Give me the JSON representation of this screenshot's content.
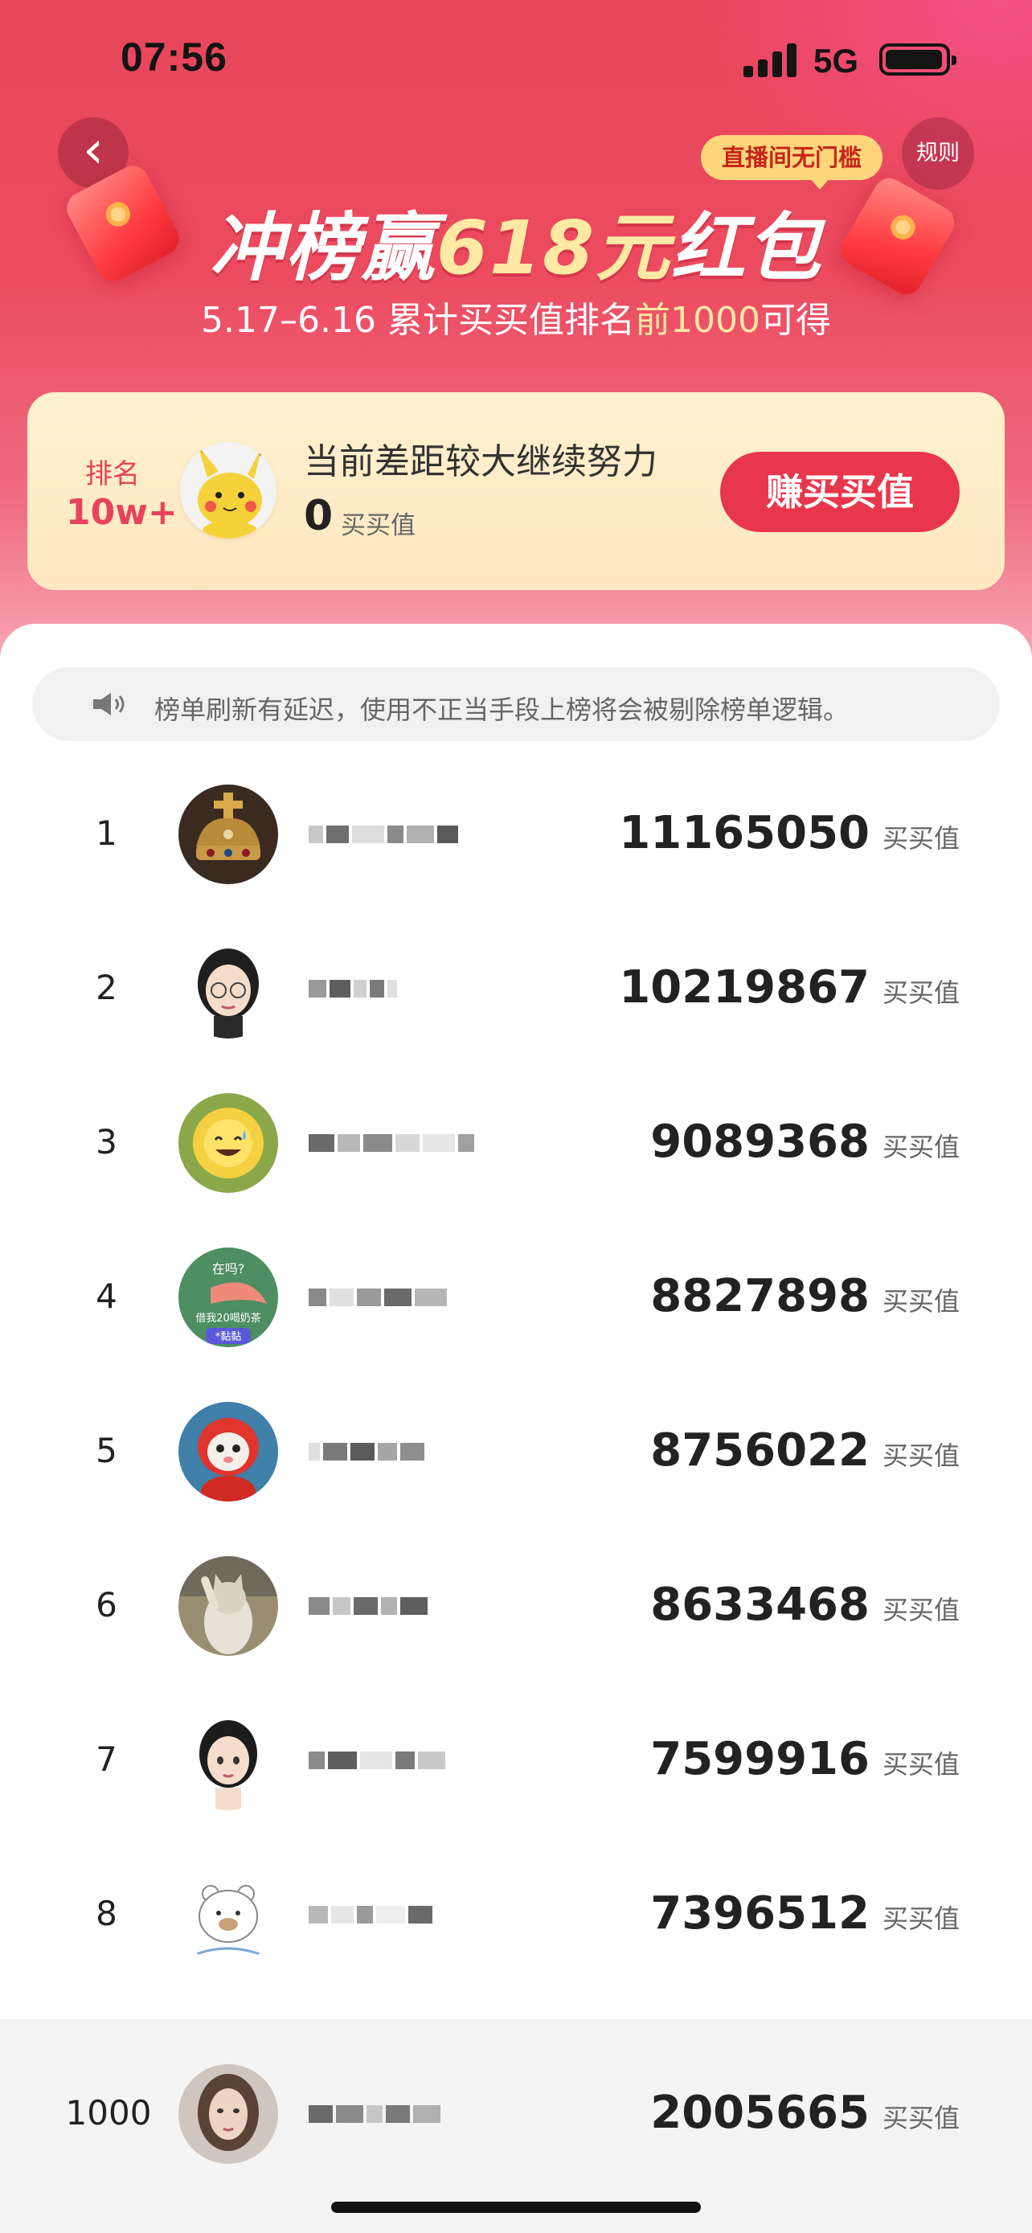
{
  "status_bar": {
    "time": "07:56",
    "network": "5G"
  },
  "header": {
    "rules_label": "规则",
    "badge": "直播间无门槛",
    "title_prefix": "冲榜赢",
    "title_highlight": "618元",
    "title_suffix": "红包",
    "subtitle_prefix": "5.17–6.16 累计买买值排名",
    "subtitle_highlight": "前1000",
    "subtitle_suffix": "可得"
  },
  "my_rank": {
    "rank_label": "排名",
    "rank_value": "10w+",
    "status": "当前差距较大继续努力",
    "score": "0",
    "score_unit": "买买值",
    "earn_button": "赚买买值"
  },
  "notice": "榜单刷新有延迟，使用不正当手段上榜将会被剔除榜单逻辑。",
  "leaderboard": [
    {
      "rank": "1",
      "score": "11165050",
      "unit": "买买值",
      "avatar": "crown"
    },
    {
      "rank": "2",
      "score": "10219867",
      "unit": "买买值",
      "avatar": "girl-glasses"
    },
    {
      "rank": "3",
      "score": "9089368",
      "unit": "买买值",
      "avatar": "sun-emoji"
    },
    {
      "rank": "4",
      "score": "8827898",
      "unit": "买买值",
      "avatar": "sticker"
    },
    {
      "rank": "5",
      "score": "8756022",
      "unit": "买买值",
      "avatar": "red-monkey"
    },
    {
      "rank": "6",
      "score": "8633468",
      "unit": "买买值",
      "avatar": "cat"
    },
    {
      "rank": "7",
      "score": "7599916",
      "unit": "买买值",
      "avatar": "girl"
    },
    {
      "rank": "8",
      "score": "7396512",
      "unit": "买买值",
      "avatar": "bear"
    }
  ],
  "bottom_entry": {
    "rank": "1000",
    "score": "2005665",
    "unit": "买买值",
    "avatar": "woman"
  },
  "avatar_stickers": {
    "top": "在吗?",
    "middle": "借我20喝奶茶",
    "bottom": "*黏黏"
  },
  "colors": {
    "accent": "#e8374d",
    "gold": "#ffe9a3",
    "card": "#fff1cf"
  }
}
